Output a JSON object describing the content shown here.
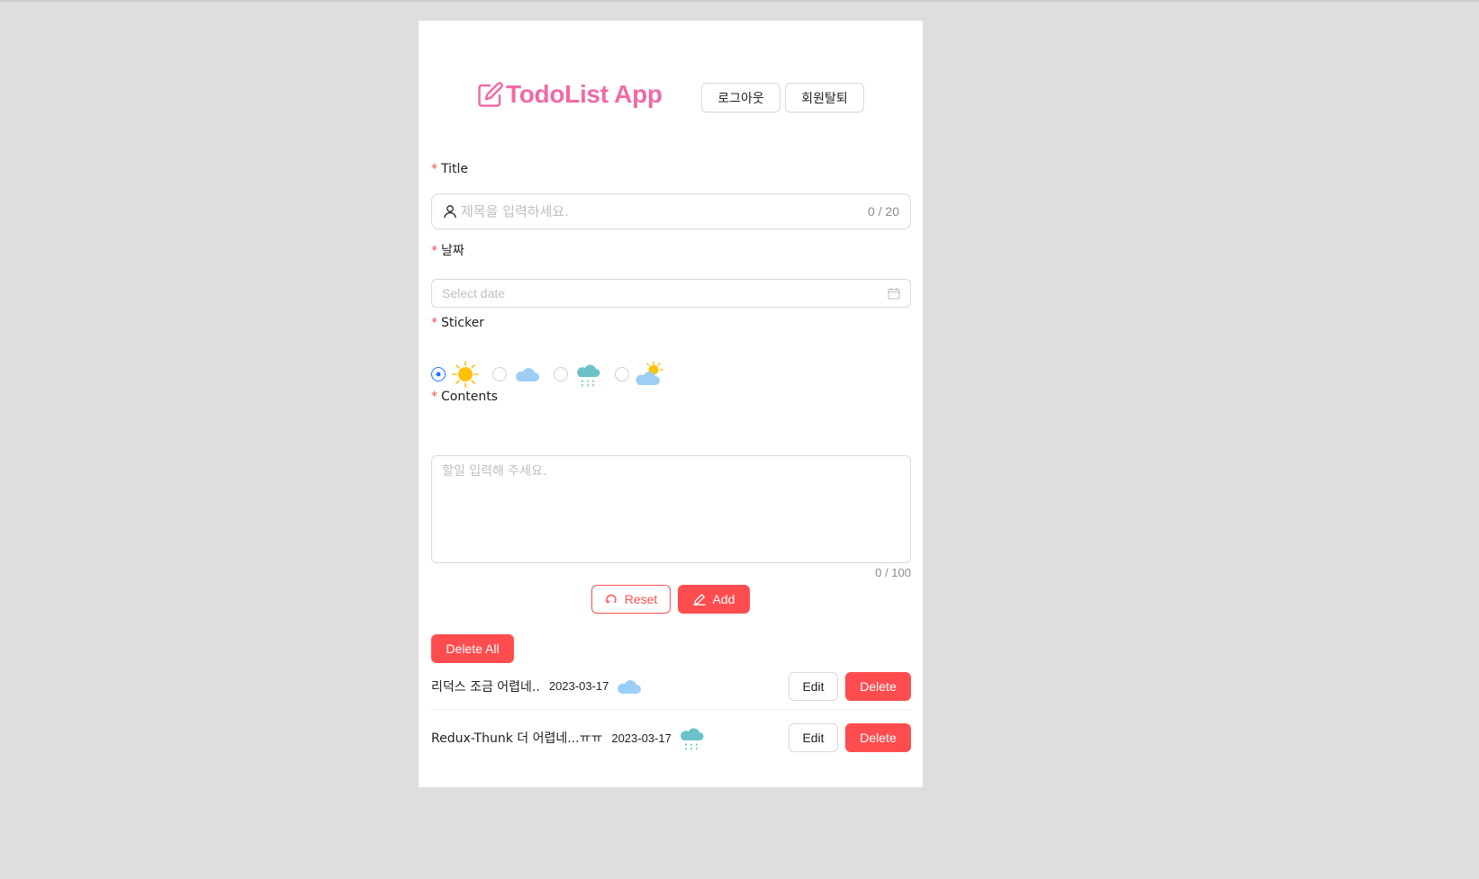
{
  "header": {
    "app_title": "TodoList App",
    "logout_label": "로그아웃",
    "withdraw_label": "회원탈퇴",
    "logo_color": "#f06aa6"
  },
  "form": {
    "title": {
      "label": "Title",
      "placeholder": "제목을 입력하세요.",
      "counter": "0 / 20",
      "icon": "user-icon"
    },
    "date": {
      "label": "날짜",
      "placeholder": "Select date",
      "icon": "calendar-icon"
    },
    "sticker": {
      "label": "Sticker",
      "options": [
        {
          "name": "sunny",
          "selected": true
        },
        {
          "name": "cloudy",
          "selected": false
        },
        {
          "name": "rainy",
          "selected": false
        },
        {
          "name": "partly-cloudy",
          "selected": false
        }
      ]
    },
    "contents": {
      "label": "Contents",
      "placeholder": "할일 입력해 주세요.",
      "counter": "0 / 100"
    },
    "reset_label": "Reset",
    "add_label": "Add"
  },
  "list": {
    "delete_all_label": "Delete All",
    "items": [
      {
        "title": "리덕스 조금 어렵네..",
        "date": "2023-03-17",
        "sticker": "cloudy",
        "edit_label": "Edit",
        "delete_label": "Delete"
      },
      {
        "title": "Redux-Thunk 더 어렵네...ㅠㅠ",
        "date": "2023-03-17",
        "sticker": "rainy",
        "edit_label": "Edit",
        "delete_label": "Delete"
      }
    ]
  },
  "colors": {
    "accent": "#ff4d4f",
    "radio": "#1677ff",
    "background": "#dedede"
  }
}
